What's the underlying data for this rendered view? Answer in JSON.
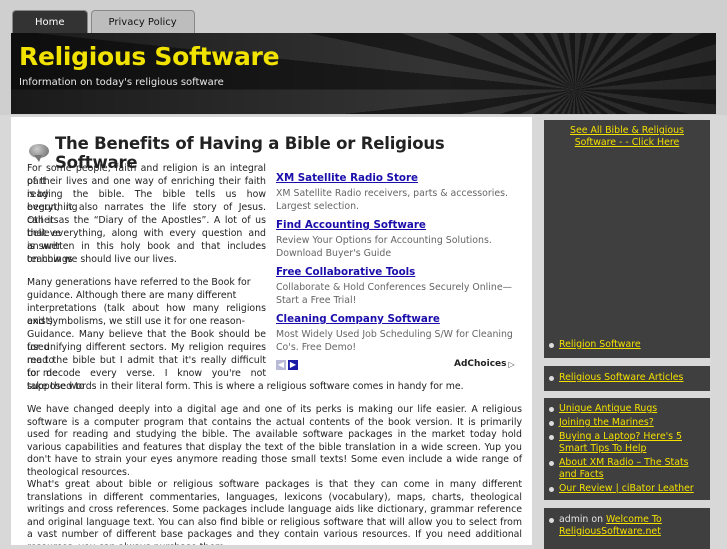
{
  "nav": {
    "tabs": [
      "Home",
      "Privacy Policy"
    ]
  },
  "header": {
    "title": "Religious Software",
    "tagline": "Information on today's religious software"
  },
  "post": {
    "title": "The Benefits of Having a Bible or Religious Software",
    "p1_lines": [
      "For some people, faith and religion is an integral part",
      "of their lives and one way of enriching their faith is by",
      "reading the bible. The bible tells us how everything",
      "begun, it also narrates the life story of Jesus. Others",
      "call it as the “Diary of the Apostles”. A lot of us believe",
      "that everything, along with every question and answer",
      "is written in this holy book and that includes teachings",
      "on how we should live our lives."
    ],
    "p2_lines": [
      "Many generations have referred to the Book for",
      "guidance. Although there are many different",
      "interpretations (talk about how many religions exist)",
      "and symbolisms, we still use it for one reason-",
      "Guidance. Many believe that the Book should be used",
      "for unifying different sectors. My religion requires me to",
      "read the bible but I admit that it's really difficult for me",
      "to decode every verse. I know you're not supposed to",
      "take the words in their literal form. This is where a religious software comes in handy for me."
    ],
    "p3": "We have changed deeply into a digital age and one of its perks is making our life easier. A religious software is a computer program that contains the actual contents of the book version. It is primarily used for reading and studying the bible. The available software packages in the market today hold various capabilities and features that display the text of the bible translation in a wide screen. Yup you don't have to strain your eyes anymore reading those small texts! Some even include a wide range of theological resources.",
    "p4": "What's great about bible or religious software packages is that they can come in many different translations in different commentaries, languages, lexicons (vocabulary), maps, charts, theological writings and cross references. Some packages include language aids like dictionary, grammar reference and original language text. You can also find bible or religious software that will allow you to select from a vast number of different base packages and they contain various resources. If you need additional resources, you can always purchase them"
  },
  "ads": {
    "items": [
      {
        "title": "XM Satellite Radio Store",
        "desc": "XM Satellite Radio receivers, parts & accessories. Largest selection."
      },
      {
        "title": "Find Accounting Software",
        "desc": "Review Your Options for Accounting Solutions. Download Buyer's Guide"
      },
      {
        "title": "Free Collaborative Tools",
        "desc": "Collaborate & Hold Conferences Securely Online—Start a Free Trial!"
      },
      {
        "title": "Cleaning Company Software",
        "desc": "Most Widely Used Job Scheduling S/W for Cleaning Co's. Free Demo!"
      }
    ],
    "prev": "◀",
    "next": "▶",
    "adchoices": "AdChoices",
    "adchoices_icon": "▷"
  },
  "sidebar": {
    "see_all": "See All Bible & Religious Software - - Click Here",
    "categories": [
      "Religion Software"
    ],
    "pages": [
      "Religious Software Articles"
    ],
    "recent": [
      "Unique Antique Rugs",
      "Joining the Marines?",
      "Buying a Laptop? Here's 5 Smart Tips To Help",
      "About XM Radio – The Stats and Facts",
      "Our Review | ciBator Leather"
    ],
    "comment": {
      "author": "admin",
      "on": "on",
      "post": "Welcome To ReligiousSoftware.net"
    }
  },
  "colors": {
    "title_yellow": "#f2e200",
    "link_yellow": "#f4e000",
    "sidebar_bg": "#3f3f3f",
    "ad_link": "#1a0dab"
  }
}
